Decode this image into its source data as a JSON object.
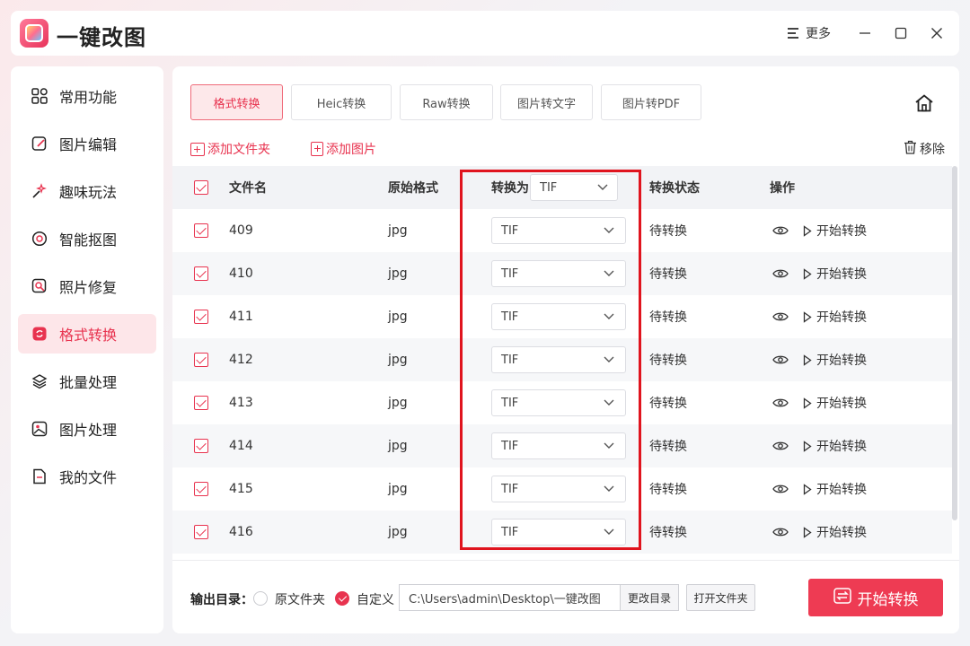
{
  "app": {
    "title": "一键改图"
  },
  "titlebar": {
    "more_label": "更多"
  },
  "sidebar": {
    "items": [
      {
        "label": "常用功能",
        "icon": "grid-icon",
        "active": false
      },
      {
        "label": "图片编辑",
        "icon": "edit-image-icon",
        "active": false
      },
      {
        "label": "趣味玩法",
        "icon": "sparkle-icon",
        "active": false
      },
      {
        "label": "智能抠图",
        "icon": "cutout-icon",
        "active": false
      },
      {
        "label": "照片修复",
        "icon": "repair-icon",
        "active": false
      },
      {
        "label": "格式转换",
        "icon": "convert-icon",
        "active": true
      },
      {
        "label": "批量处理",
        "icon": "layers-icon",
        "active": false
      },
      {
        "label": "图片处理",
        "icon": "image-icon",
        "active": false
      },
      {
        "label": "我的文件",
        "icon": "file-icon",
        "active": false
      }
    ]
  },
  "tabs": [
    {
      "label": "格式转换",
      "active": true
    },
    {
      "label": "Heic转换",
      "active": false
    },
    {
      "label": "Raw转换",
      "active": false
    },
    {
      "label": "图片转文字",
      "active": false
    },
    {
      "label": "图片转PDF",
      "active": false
    }
  ],
  "toolbar": {
    "add_folder": "添加文件夹",
    "add_image": "添加图片",
    "remove": "移除"
  },
  "table": {
    "headers": {
      "filename": "文件名",
      "orig_format": "原始格式",
      "convert_to": "转换为",
      "status": "转换状态",
      "actions": "操作"
    },
    "header_select_value": "TIF",
    "rows": [
      {
        "name": "409",
        "format": "jpg",
        "target": "TIF",
        "status": "待转换",
        "action": "开始转换"
      },
      {
        "name": "410",
        "format": "jpg",
        "target": "TIF",
        "status": "待转换",
        "action": "开始转换"
      },
      {
        "name": "411",
        "format": "jpg",
        "target": "TIF",
        "status": "待转换",
        "action": "开始转换"
      },
      {
        "name": "412",
        "format": "jpg",
        "target": "TIF",
        "status": "待转换",
        "action": "开始转换"
      },
      {
        "name": "413",
        "format": "jpg",
        "target": "TIF",
        "status": "待转换",
        "action": "开始转换"
      },
      {
        "name": "414",
        "format": "jpg",
        "target": "TIF",
        "status": "待转换",
        "action": "开始转换"
      },
      {
        "name": "415",
        "format": "jpg",
        "target": "TIF",
        "status": "待转换",
        "action": "开始转换"
      },
      {
        "name": "416",
        "format": "jpg",
        "target": "TIF",
        "status": "待转换",
        "action": "开始转换"
      }
    ]
  },
  "footer": {
    "output_label": "输出目录：",
    "option_original": "原文件夹",
    "option_custom": "自定义",
    "path": "C:\\Users\\admin\\Desktop\\一键改图",
    "change_dir": "更改目录",
    "open_folder": "打开文件夹",
    "start_all": "开始转换"
  },
  "colors": {
    "accent": "#e8334f",
    "highlight_box": "#e0141e"
  }
}
